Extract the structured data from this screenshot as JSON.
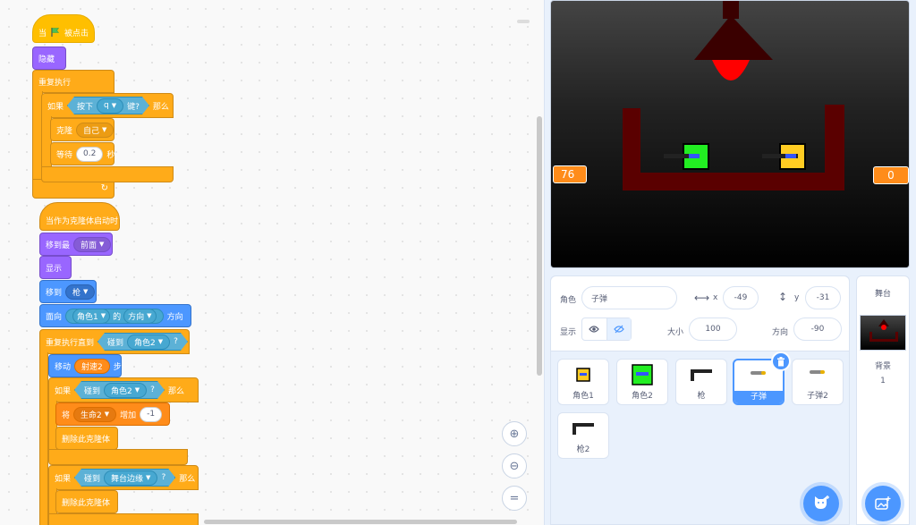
{
  "scripts": {
    "s1_hat_when": "当",
    "s1_hat_clicked": "被点击",
    "hide": "隐藏",
    "forever": "重复执行",
    "if_label": "如果",
    "key_pressed": "按下",
    "key_value": "q",
    "key_suffix": "键?",
    "then": "那么",
    "clone": "克隆",
    "clone_target": "自己",
    "wait": "等待",
    "wait_value": "0.2",
    "wait_unit": "秒",
    "s2_hat": "当作为克隆体启动时",
    "goto_layer": "移到最",
    "layer_value": "前面",
    "show": "显示",
    "goto": "移到",
    "goto_target": "枪",
    "point": "面向",
    "point_sprite": "角色1",
    "point_of": "的",
    "point_prop": "方向",
    "point_suffix": "方向",
    "repeat_until": "重复执行直到",
    "touching": "碰到",
    "touch_target1": "角色2",
    "q": "?",
    "move": "移动",
    "move_var": "射速2",
    "move_unit": "步",
    "touch_target2": "角色2",
    "set_prefix": "将",
    "set_var": "生命2",
    "change": "增加",
    "change_value": "-1",
    "delete_clone": "删除此克隆体",
    "touch_edge": "舞台边缘",
    "delete_clone2": "删除此克隆体"
  },
  "stage": {
    "monitor_left": "76",
    "monitor_right": "0"
  },
  "sprite_info": {
    "sprite_label": "角色",
    "sprite_name": "子弹",
    "x_label": "x",
    "x_value": "-49",
    "y_label": "y",
    "y_value": "-31",
    "show_label": "显示",
    "size_label": "大小",
    "size_value": "100",
    "direction_label": "方向",
    "direction_value": "-90"
  },
  "sprites": [
    {
      "name": "角色1"
    },
    {
      "name": "角色2"
    },
    {
      "name": "枪"
    },
    {
      "name": "子弹"
    },
    {
      "name": "子弹2"
    },
    {
      "name": "枪2"
    }
  ],
  "stage_pane": {
    "title": "舞台",
    "backdrop_label": "背景",
    "backdrop_count": "1"
  },
  "colors": {
    "events": "#ffbf00",
    "control": "#ffab19",
    "looks": "#9966ff",
    "motion": "#4c97ff",
    "sensing": "#5cb1d6",
    "variables": "#ff8c1a",
    "accent": "#4c97ff"
  },
  "icons": {
    "flag": "green-flag-icon",
    "zoom_in": "zoom-in-icon",
    "zoom_out": "zoom-out-icon",
    "zoom_reset": "zoom-reset-icon",
    "eye": "eye-icon",
    "eye_off": "eye-off-icon",
    "delete": "trash-icon",
    "add_sprite": "cat-add-icon",
    "add_backdrop": "backdrop-add-icon"
  }
}
